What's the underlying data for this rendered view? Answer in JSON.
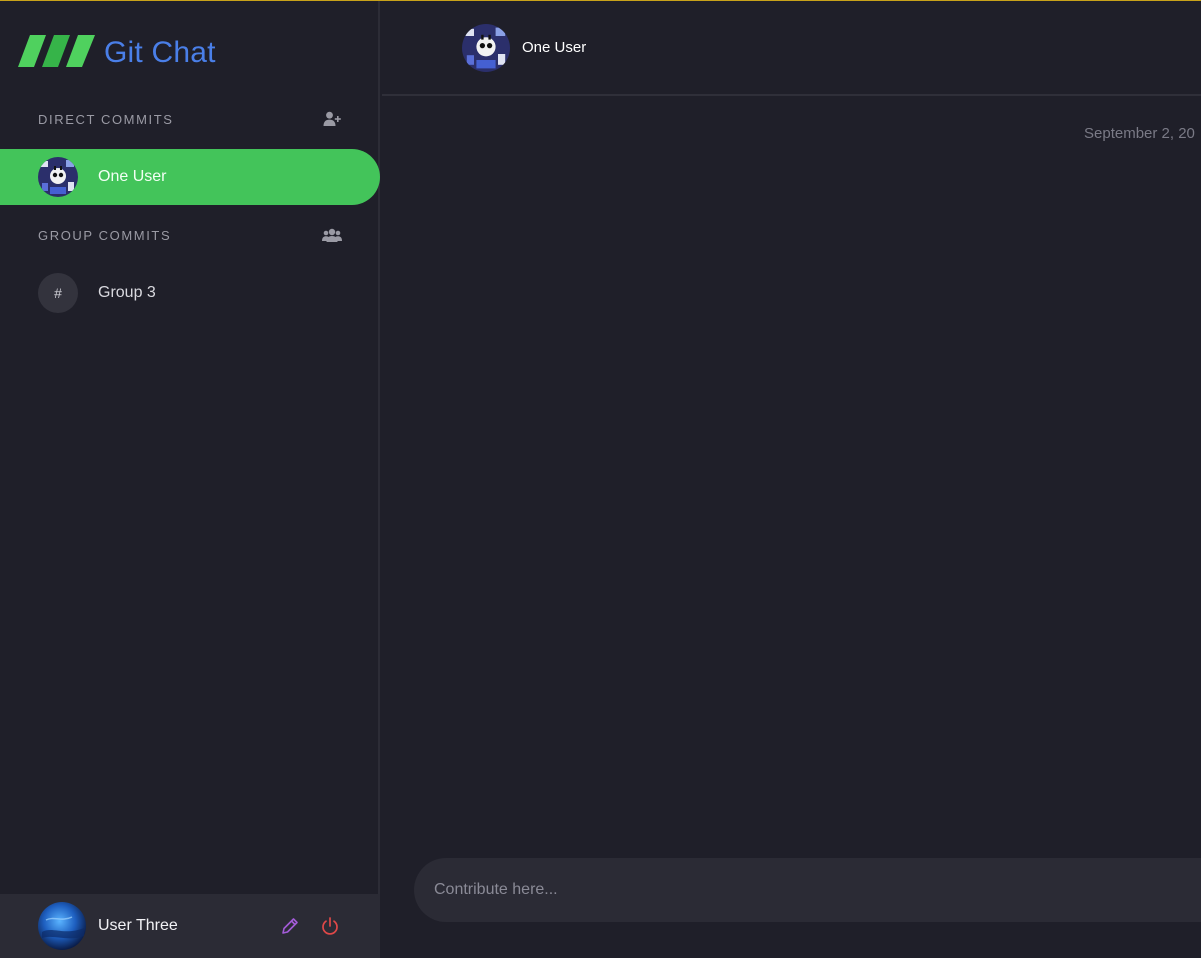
{
  "app": {
    "title": "Git Chat"
  },
  "sidebar": {
    "direct_section": {
      "title": "DIRECT COMMITS",
      "icon": "add-user-icon"
    },
    "direct_items": [
      {
        "name": "One User",
        "active": true
      }
    ],
    "group_section": {
      "title": "GROUP COMMITS",
      "icon": "group-icon"
    },
    "group_items": [
      {
        "symbol": "#",
        "name": "Group 3"
      }
    ]
  },
  "current_user": {
    "name": "User Three",
    "edit_icon": "pencil-icon",
    "logout_icon": "power-icon"
  },
  "chat": {
    "header_name": "One User",
    "date_separator": "September 2, 20",
    "composer_placeholder": "Contribute here..."
  },
  "colors": {
    "accent_green": "#43c45a",
    "brand_blue": "#4a7fe8",
    "edit_purple": "#a35bd8",
    "logout_red": "#e04848"
  }
}
